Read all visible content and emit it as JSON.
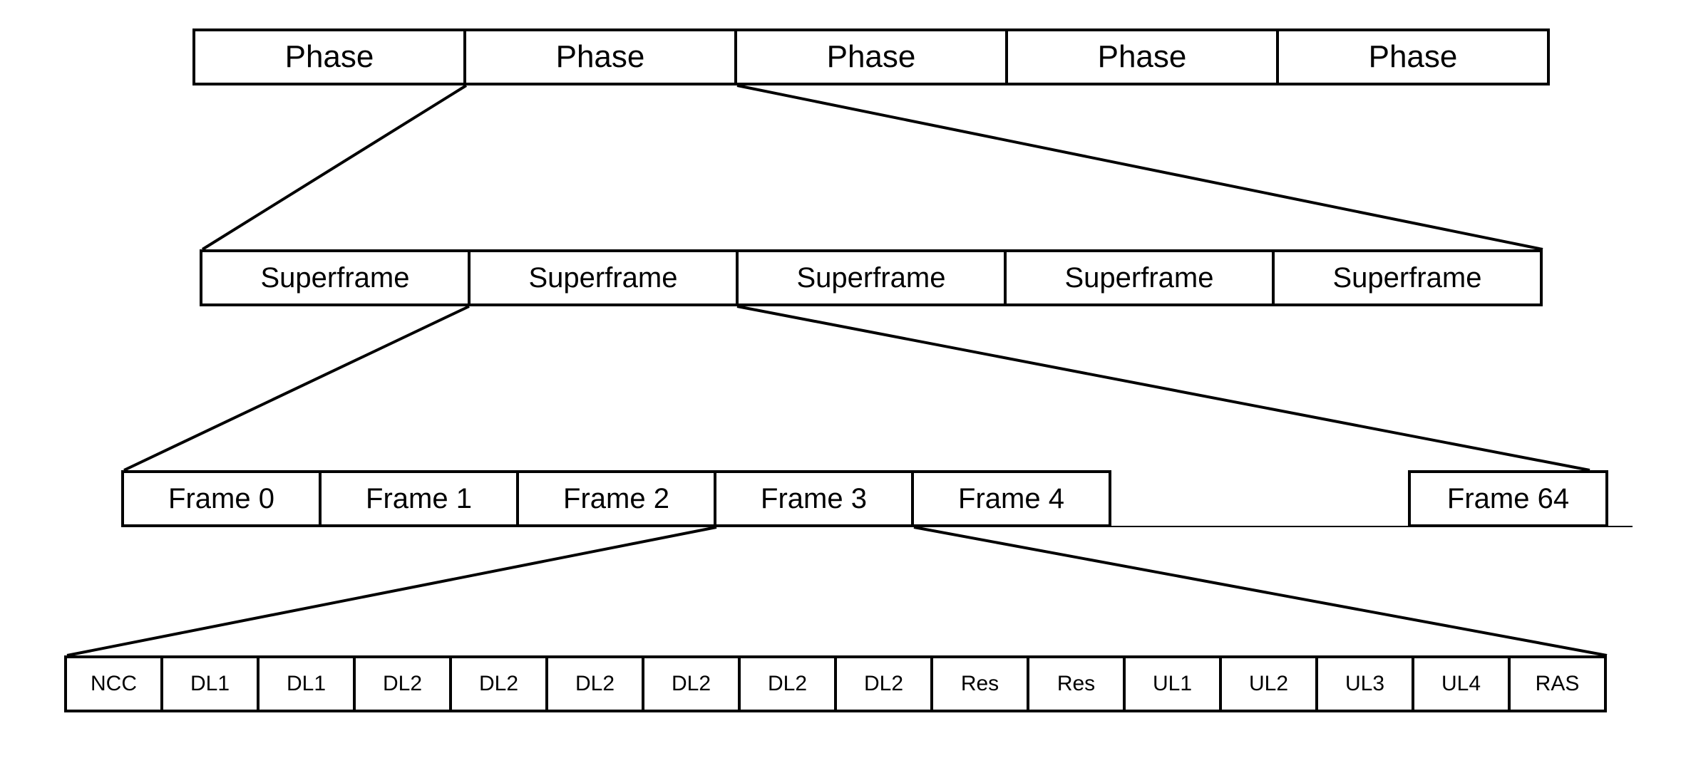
{
  "phases": [
    "Phase",
    "Phase",
    "Phase",
    "Phase",
    "Phase"
  ],
  "superframes": [
    "Superframe",
    "Superframe",
    "Superframe",
    "Superframe",
    "Superframe"
  ],
  "frames": [
    "Frame 0",
    "Frame 1",
    "Frame 2",
    "Frame 3",
    "Frame 4"
  ],
  "frame_last": "Frame 64",
  "slots": [
    "NCC",
    "DL1",
    "DL1",
    "DL2",
    "DL2",
    "DL2",
    "DL2",
    "DL2",
    "DL2",
    "Res",
    "Res",
    "UL1",
    "UL2",
    "UL3",
    "UL4",
    "RAS"
  ]
}
